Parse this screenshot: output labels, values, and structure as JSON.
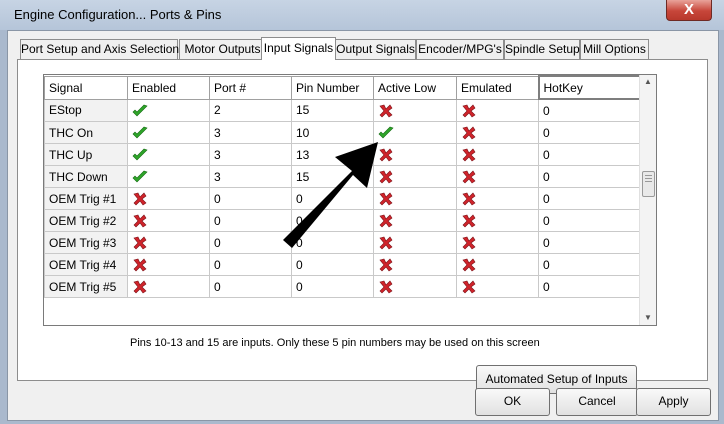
{
  "window": {
    "title": "Engine Configuration... Ports & Pins",
    "close_label": "X"
  },
  "tabs": [
    {
      "label": "Port Setup and Axis Selection"
    },
    {
      "label": "Motor Outputs"
    },
    {
      "label": "Input Signals"
    },
    {
      "label": "Output Signals"
    },
    {
      "label": "Encoder/MPG's"
    },
    {
      "label": "Spindle Setup"
    },
    {
      "label": "Mill Options"
    }
  ],
  "active_tab": "Input Signals",
  "table": {
    "columns": [
      "Signal",
      "Enabled",
      "Port #",
      "Pin Number",
      "Active Low",
      "Emulated",
      "HotKey"
    ],
    "rows": [
      {
        "signal": "EStop",
        "enabled": "check",
        "port": "2",
        "pin": "15",
        "active_low": "cross",
        "emulated": "cross",
        "hotkey": "0"
      },
      {
        "signal": "THC On",
        "enabled": "check",
        "port": "3",
        "pin": "10",
        "active_low": "check",
        "emulated": "cross",
        "hotkey": "0"
      },
      {
        "signal": "THC Up",
        "enabled": "check",
        "port": "3",
        "pin": "13",
        "active_low": "cross",
        "emulated": "cross",
        "hotkey": "0"
      },
      {
        "signal": "THC Down",
        "enabled": "check",
        "port": "3",
        "pin": "15",
        "active_low": "cross",
        "emulated": "cross",
        "hotkey": "0"
      },
      {
        "signal": "OEM Trig #1",
        "enabled": "cross",
        "port": "0",
        "pin": "0",
        "active_low": "cross",
        "emulated": "cross",
        "hotkey": "0"
      },
      {
        "signal": "OEM Trig #2",
        "enabled": "cross",
        "port": "0",
        "pin": "0",
        "active_low": "cross",
        "emulated": "cross",
        "hotkey": "0"
      },
      {
        "signal": "OEM Trig #3",
        "enabled": "cross",
        "port": "0",
        "pin": "0",
        "active_low": "cross",
        "emulated": "cross",
        "hotkey": "0"
      },
      {
        "signal": "OEM Trig #4",
        "enabled": "cross",
        "port": "0",
        "pin": "0",
        "active_low": "cross",
        "emulated": "cross",
        "hotkey": "0"
      },
      {
        "signal": "OEM Trig #5",
        "enabled": "cross",
        "port": "0",
        "pin": "0",
        "active_low": "cross",
        "emulated": "cross",
        "hotkey": "0"
      }
    ]
  },
  "note": "Pins 10-13 and 15 are inputs. Only these 5 pin numbers may be used on this screen",
  "buttons": {
    "automated_setup": "Automated Setup of Inputs",
    "ok": "OK",
    "cancel": "Cancel",
    "apply": "Apply"
  },
  "colors": {
    "check": "#2fa52a",
    "cross": "#d0242b"
  }
}
